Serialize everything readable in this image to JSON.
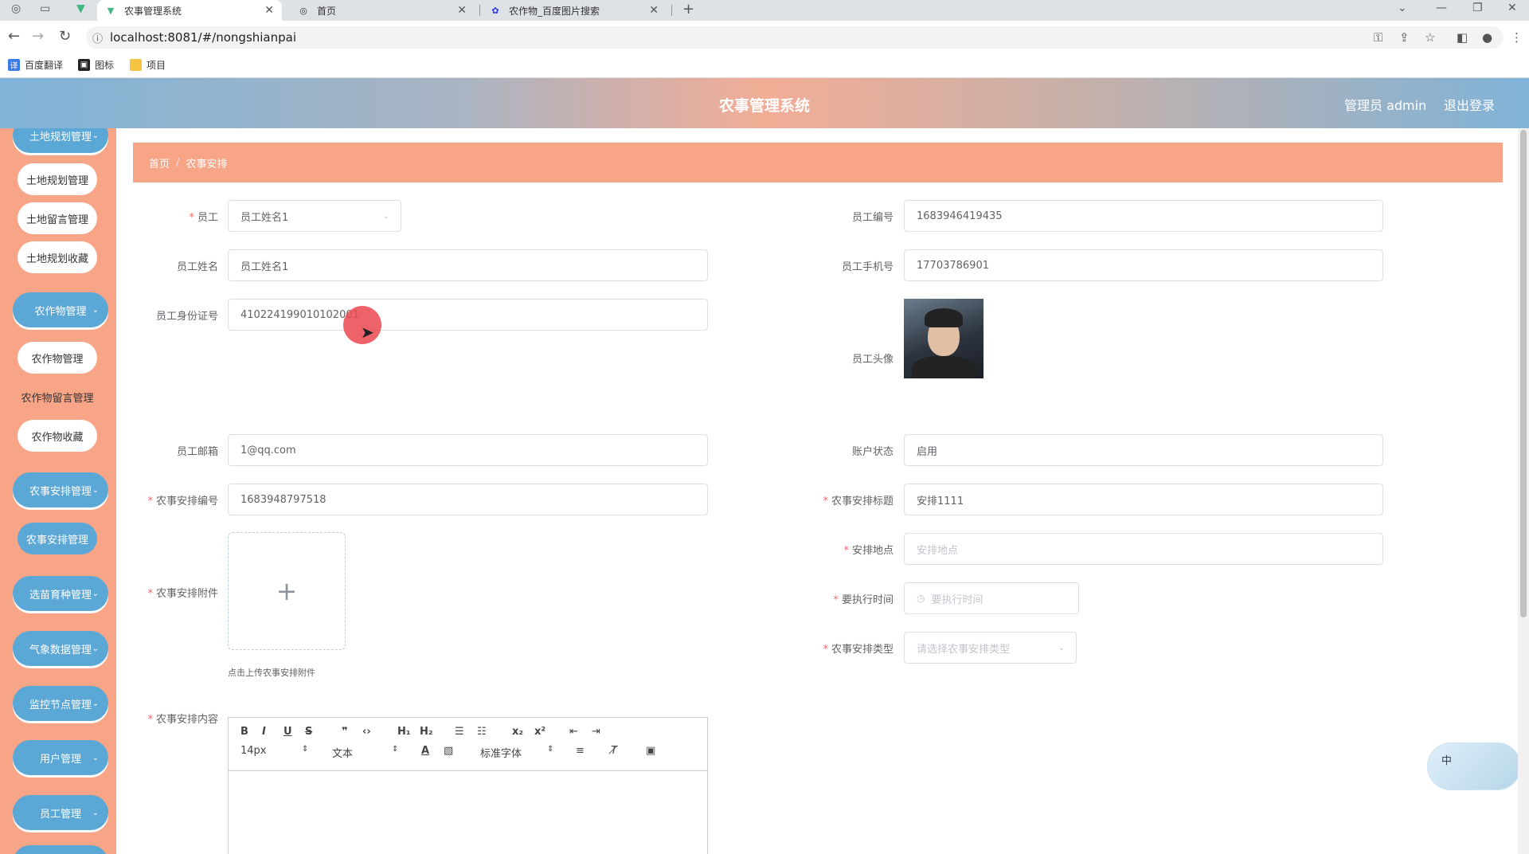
{
  "browser": {
    "tabs": [
      {
        "title": "农事管理系统",
        "active": true
      },
      {
        "title": "首页",
        "active": false
      },
      {
        "title": "农作物_百度图片搜索",
        "active": false
      }
    ],
    "new_tab": "+",
    "url": "localhost:8081/#/nongshianpai",
    "bookmarks": [
      "百度翻译",
      "图标",
      "项目"
    ]
  },
  "header": {
    "title": "农事管理系统",
    "user": "管理员 admin",
    "logout": "退出登录"
  },
  "sidebar": {
    "items": [
      {
        "label": "土地规划管理",
        "type": "main"
      },
      {
        "label": "土地规划管理",
        "type": "sub"
      },
      {
        "label": "土地留言管理",
        "type": "sub"
      },
      {
        "label": "土地规划收藏",
        "type": "sub"
      },
      {
        "label": "农作物管理",
        "type": "main"
      },
      {
        "label": "农作物管理",
        "type": "sub"
      },
      {
        "label": "农作物留言管理",
        "type": "sub"
      },
      {
        "label": "农作物收藏",
        "type": "sub"
      },
      {
        "label": "农事安排管理",
        "type": "main"
      },
      {
        "label": "农事安排管理",
        "type": "sub-active"
      },
      {
        "label": "选苗育种管理",
        "type": "main"
      },
      {
        "label": "气象数据管理",
        "type": "main"
      },
      {
        "label": "监控节点管理",
        "type": "main"
      },
      {
        "label": "用户管理",
        "type": "main"
      },
      {
        "label": "员工管理",
        "type": "main"
      }
    ]
  },
  "breadcrumb": {
    "home": "首页",
    "sep": "/",
    "current": "农事安排"
  },
  "form": {
    "employee_label": "员工",
    "employee_value": "员工姓名1",
    "employee_no_label": "员工编号",
    "employee_no_value": "1683946419435",
    "employee_name_label": "员工姓名",
    "employee_name_value": "员工姓名1",
    "employee_phone_label": "员工手机号",
    "employee_phone_value": "17703786901",
    "employee_id_label": "员工身份证号",
    "employee_id_value": "410224199010102001",
    "employee_avatar_label": "员工头像",
    "employee_email_label": "员工邮箱",
    "employee_email_value": "1@qq.com",
    "account_status_label": "账户状态",
    "account_status_value": "启用",
    "arrangement_no_label": "农事安排编号",
    "arrangement_no_value": "1683948797518",
    "arrangement_title_label": "农事安排标题",
    "arrangement_title_value": "安排1111",
    "attachment_label": "农事安排附件",
    "attachment_tip": "点击上传农事安排附件",
    "location_label": "安排地点",
    "location_placeholder": "安排地点",
    "exec_time_label": "要执行时间",
    "exec_time_placeholder": "要执行时间",
    "type_label": "农事安排类型",
    "type_placeholder": "请选择农事安排类型",
    "content_label": "农事安排内容"
  },
  "editor": {
    "size": "14px",
    "format": "文本",
    "font": "标准字体"
  },
  "widget": {
    "label": "中"
  },
  "colors": {
    "accent": "#5ba7d6",
    "sidebar": "#f8a587",
    "required": "#f56c6c"
  }
}
